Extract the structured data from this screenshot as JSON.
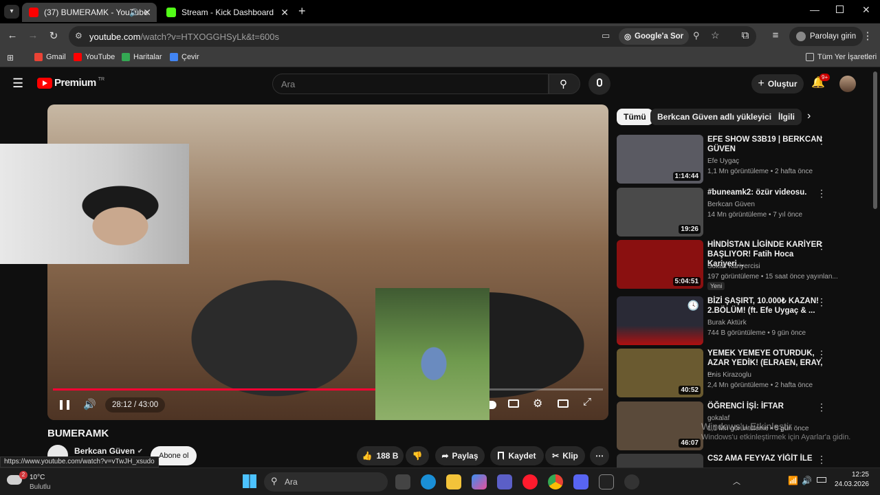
{
  "browser": {
    "tabs": [
      {
        "title": "(37) BUMERAMK - YouTube",
        "active": true,
        "favicon_color": "#ff0000"
      },
      {
        "title": "Stream - Kick Dashboard",
        "active": false,
        "favicon_color": "#53fc18"
      }
    ],
    "url": {
      "host": "youtube.com",
      "path": "/watch?v=HTXOGGHSyLk&t=600s"
    },
    "google_btn": "Google'a Sor",
    "profile_btn": "Parolayı girin",
    "bookmarks": [
      "Gmail",
      "YouTube",
      "Haritalar",
      "Çevir"
    ],
    "all_bookmarks": "Tüm Yer İşaretleri",
    "status_url": "https://www.youtube.com/watch?v=vTwJH_xsudo"
  },
  "youtube": {
    "logo": "Premium",
    "logo_sup": "TR",
    "search_placeholder": "Ara",
    "create_label": "Oluştur",
    "notif_badge": "9+",
    "player": {
      "time": "28:12 / 43:00",
      "progress": 0.656,
      "buffered": 1.0
    },
    "video_title": "BUMERAMK",
    "channel": "Berkcan Güven",
    "subscribe": "Abone ol",
    "actions": {
      "likes": "188 B",
      "share": "Paylaş",
      "save": "Kaydet",
      "clip": "Klip"
    },
    "chips": [
      "Tümü",
      "Berkcan Güven adlı yükleyiciden",
      "İlgili"
    ],
    "recs": [
      {
        "title": "EFE SHOW S3B19 | BERKCAN GÜVEN",
        "channel": "Efe Uygaç",
        "meta": "1,1 Mn görüntüleme • 2 hafta önce",
        "duration": "1:14:44",
        "thumb_color": "#5a5a62"
      },
      {
        "title": "#buneamk2: özür videosu.",
        "channel": "Berkcan Güven",
        "meta": "14 Mn görüntüleme • 7 yıl önce",
        "duration": "19:26",
        "thumb_color": "#4a4a4a"
      },
      {
        "title": "HİNDİSTAN LİGİNDE KARİYER BAŞLIYOR! Fatih Hoca Kariyeri...",
        "channel": "Sokak Kariyercisi",
        "meta": "197 görüntüleme • 15 saat önce yayınlan...",
        "duration": "5:04:51",
        "badge": "Yeni",
        "thumb_color": "#8a1010"
      },
      {
        "title": "BİZİ ŞAŞIRT, 10.000₺ KAZAN! 2.BÖLÜM! (ft. Efe Uygaç & ...",
        "channel": "Burak Aktürk",
        "meta": "744 B görüntüleme • 9 gün önce",
        "duration": "",
        "thumb_color": "#2a2a36"
      },
      {
        "title": "YEMEK YEMEYE OTURDUK, AZAR YEDİK! (ELRAEN, ERAY, ...",
        "channel": "Enis Kirazoglu",
        "meta": "2,4 Mn görüntüleme • 2 hafta önce",
        "duration": "40:52",
        "thumb_color": "#6a5a30"
      },
      {
        "title": "ÖĞRENCİ İŞİ: İFTAR",
        "channel": "gokalaf",
        "meta": "1,1 Mn görüntüleme • 5 gün önce",
        "duration": "46:07",
        "thumb_color": "#5a4a3a"
      },
      {
        "title": "CS2 AMA FEYYAZ YİĞİT İLE",
        "channel": "",
        "meta": "",
        "duration": "",
        "thumb_color": "#3a3a3a"
      }
    ]
  },
  "watermark": {
    "line1": "Windows'u Etkinleştir",
    "line2": "Windows'u etkinleştirmek için Ayarlar'a gidin."
  },
  "taskbar": {
    "weather_temp": "10°C",
    "weather_desc": "Bulutlu",
    "weather_badge": "2",
    "search": "Ara",
    "time": "12:25",
    "date": "24.03.2026"
  }
}
